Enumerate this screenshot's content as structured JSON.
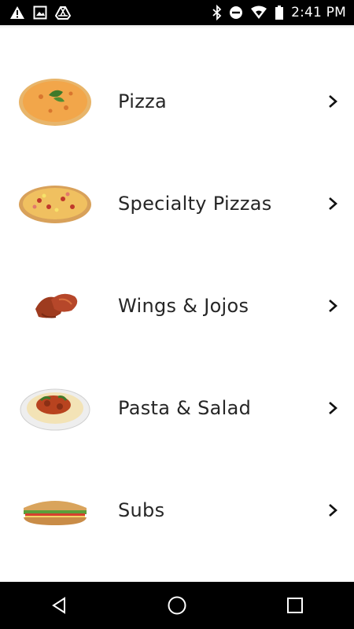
{
  "status_bar": {
    "time": "2:41 PM",
    "left_icons": [
      "warning-icon",
      "image-icon",
      "drive-icon"
    ],
    "right_icons": [
      "bluetooth-icon",
      "do-not-disturb-icon",
      "wifi-icon",
      "battery-icon"
    ]
  },
  "menu": {
    "items": [
      {
        "label": "Pizza",
        "image": "pizza-image"
      },
      {
        "label": "Specialty Pizzas",
        "image": "specialty-pizza-image"
      },
      {
        "label": "Wings & Jojos",
        "image": "wings-image"
      },
      {
        "label": "Pasta & Salad",
        "image": "pasta-image"
      },
      {
        "label": "Subs",
        "image": "sub-sandwich-image"
      }
    ]
  },
  "nav_bar": {
    "buttons": [
      "back-icon",
      "home-icon",
      "recents-icon"
    ]
  },
  "colors": {
    "status_bar_bg": "#000000",
    "text": "#262626",
    "background": "#ffffff"
  }
}
